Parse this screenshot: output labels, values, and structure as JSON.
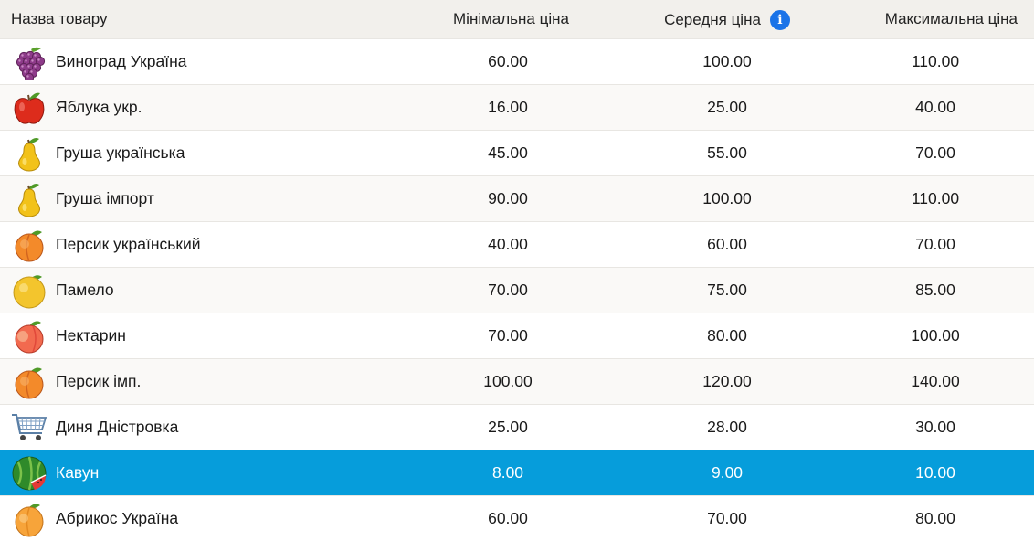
{
  "table": {
    "columns": {
      "name": "Назва товару",
      "min": "Мінімальна ціна",
      "avg": "Середня ціна",
      "max": "Максимальна ціна"
    },
    "rows": [
      {
        "name": "Виноград Україна",
        "icon": "grapes-icon",
        "min": "60.00",
        "avg": "100.00",
        "max": "110.00"
      },
      {
        "name": "Яблука укр.",
        "icon": "apple-icon",
        "min": "16.00",
        "avg": "25.00",
        "max": "40.00"
      },
      {
        "name": "Груша українська",
        "icon": "pear-icon",
        "min": "45.00",
        "avg": "55.00",
        "max": "70.00"
      },
      {
        "name": "Груша імпорт",
        "icon": "pear-icon",
        "min": "90.00",
        "avg": "100.00",
        "max": "110.00"
      },
      {
        "name": "Персик український",
        "icon": "peach-icon",
        "min": "40.00",
        "avg": "60.00",
        "max": "70.00"
      },
      {
        "name": "Памело",
        "icon": "pomelo-icon",
        "min": "70.00",
        "avg": "75.00",
        "max": "85.00"
      },
      {
        "name": "Нектарин",
        "icon": "nectarine-icon",
        "min": "70.00",
        "avg": "80.00",
        "max": "100.00"
      },
      {
        "name": "Персик імп.",
        "icon": "peach-icon",
        "min": "100.00",
        "avg": "120.00",
        "max": "140.00"
      },
      {
        "name": "Диня Дністровка",
        "icon": "shopping-cart-icon",
        "min": "25.00",
        "avg": "28.00",
        "max": "30.00"
      },
      {
        "name": "Кавун",
        "icon": "watermelon-icon",
        "min": "8.00",
        "avg": "9.00",
        "max": "10.00"
      },
      {
        "name": "Абрикос Україна",
        "icon": "apricot-icon",
        "min": "60.00",
        "avg": "70.00",
        "max": "80.00"
      }
    ]
  },
  "colors": {
    "header_bg": "#f2f0ec",
    "selected_bg": "#069ddb",
    "info_icon": "#1a73e8"
  }
}
